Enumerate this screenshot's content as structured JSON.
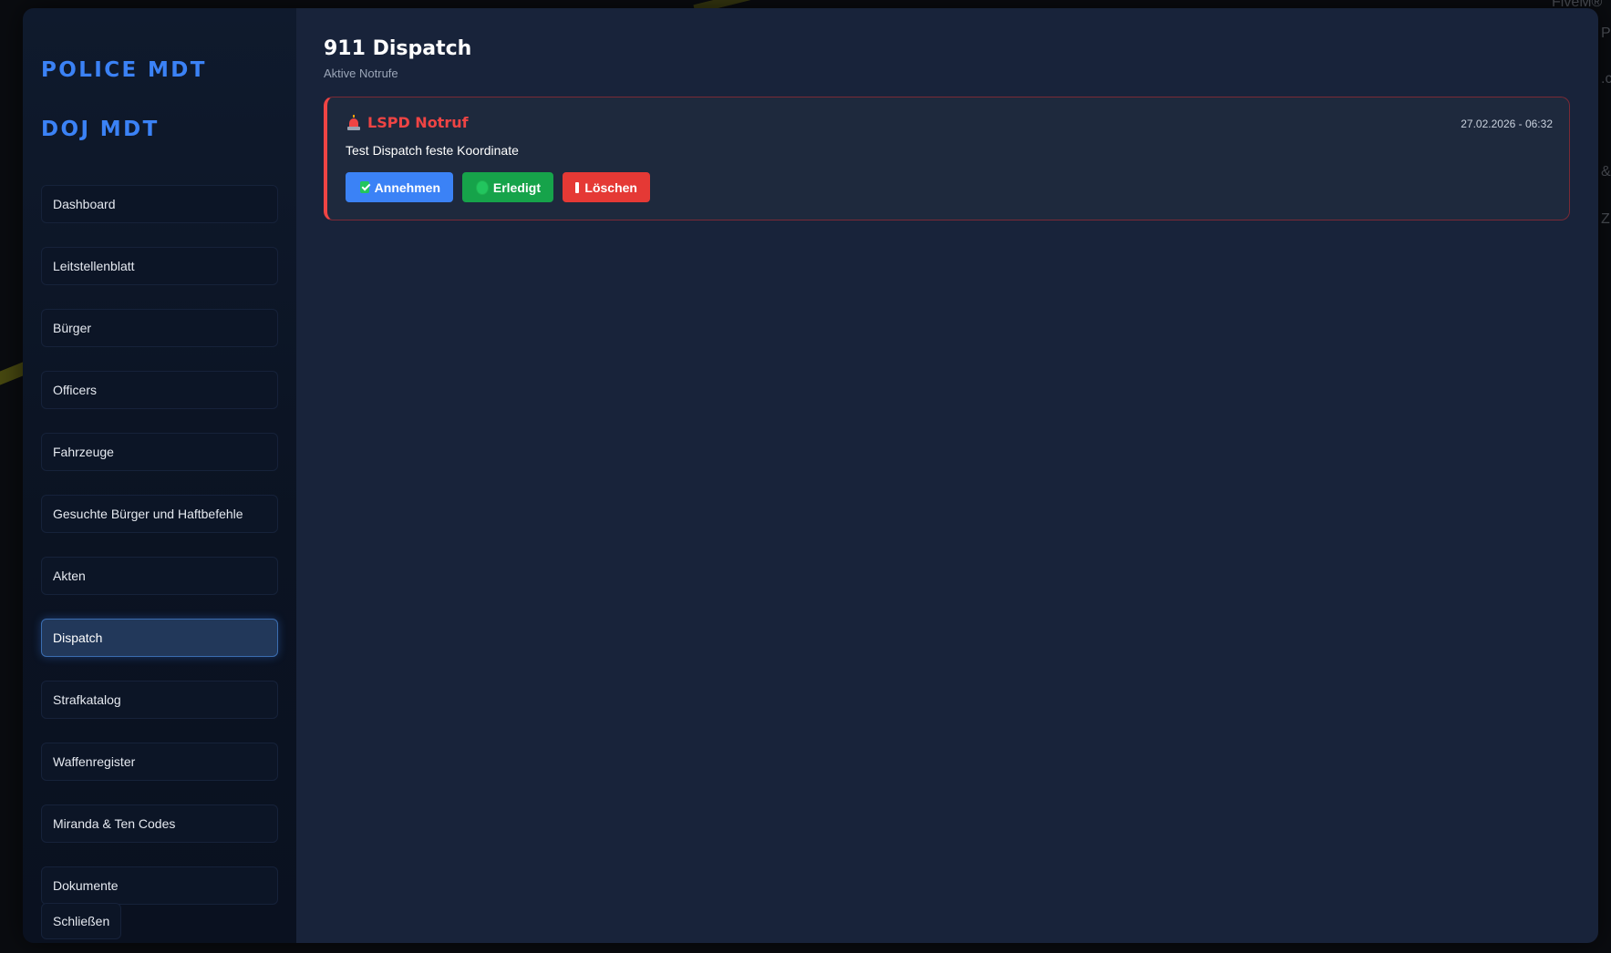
{
  "background": {
    "corner_text_top": "FiveM® (",
    "edge_fragments": [
      "P",
      ".c",
      "&",
      "Z"
    ]
  },
  "sidebar": {
    "brands": [
      "POLICE MDT",
      "DOJ MDT"
    ],
    "items": [
      {
        "label": "Dashboard",
        "active": false
      },
      {
        "label": "Leitstellenblatt",
        "active": false
      },
      {
        "label": "Bürger",
        "active": false
      },
      {
        "label": "Officers",
        "active": false
      },
      {
        "label": "Fahrzeuge",
        "active": false
      },
      {
        "label": "Gesuchte Bürger und Haftbefehle",
        "active": false
      },
      {
        "label": "Akten",
        "active": false
      },
      {
        "label": "Dispatch",
        "active": true
      },
      {
        "label": "Strafkatalog",
        "active": false
      },
      {
        "label": "Waffenregister",
        "active": false
      },
      {
        "label": "Miranda & Ten Codes",
        "active": false
      },
      {
        "label": "Dokumente",
        "active": false
      }
    ],
    "close_label": "Schließen"
  },
  "main": {
    "title": "911 Dispatch",
    "subtitle": "Aktive Notrufe",
    "dispatches": [
      {
        "icon": "siren-icon",
        "title": "LSPD Notruf",
        "timestamp": "27.02.2026 - 06:32",
        "description": "Test Dispatch feste Koordinate",
        "actions": {
          "accept_label": "Annehmen",
          "done_label": "Erledigt",
          "delete_label": "Löschen"
        }
      }
    ]
  },
  "colors": {
    "accent": "#3b82f6",
    "danger": "#ef4444",
    "success": "#16a34a",
    "sidebar_bg": "#0b1322",
    "main_bg": "#18233a"
  }
}
